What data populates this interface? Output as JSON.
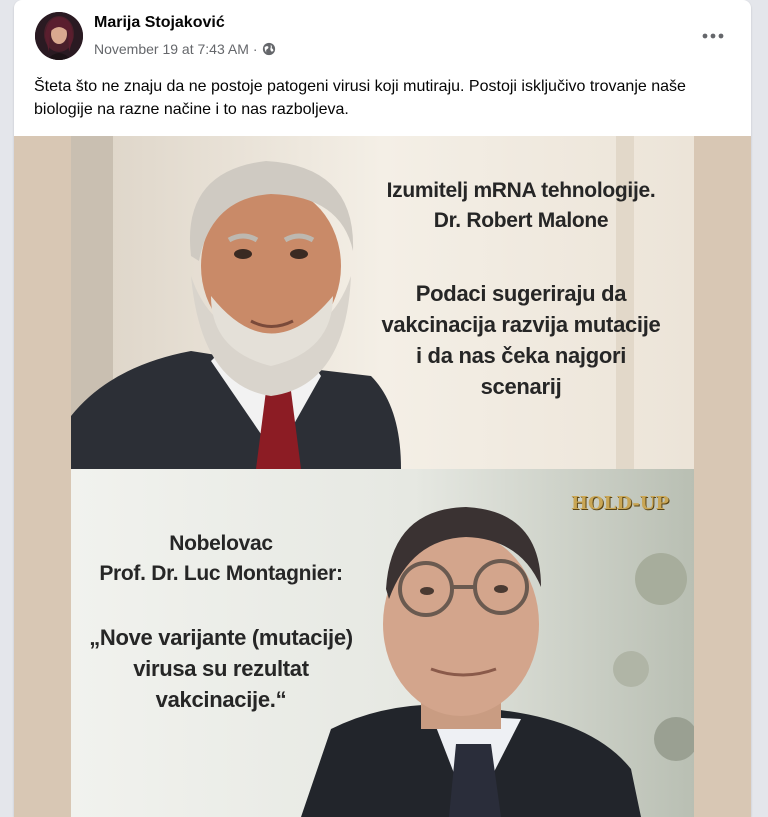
{
  "post": {
    "author": "Marija Stojaković",
    "timestamp": "November 19 at 7:43 AM",
    "separator": "·",
    "audience_icon": "globe-icon",
    "more_icon": "more-options-icon",
    "caption": "Šteta što ne znaju da ne postoje patogeni virusi koji mutiraju. Postoji isključivo trovanje naše biologije na razne načine i to nas razboljeva."
  },
  "meme": {
    "top": {
      "line1": "Izumitelj mRNA tehnologije.",
      "line2": "Dr. Robert Malone",
      "quote1": "Podaci sugeriraju da",
      "quote2": "vakcinacija razvija mutacije",
      "quote3": "i da nas čeka najgori",
      "quote4": "scenarij"
    },
    "bottom": {
      "line1": "Nobelovac",
      "line2": "Prof. Dr. Luc Montagnier:",
      "quote1": "„Nove varijante (mutacije)",
      "quote2": "virusa su rezultat",
      "quote3": "vakcinacije.“",
      "watermark": "HOLD-UP"
    }
  },
  "colors": {
    "text_primary": "#050505",
    "text_secondary": "#65676b",
    "frame_background": "#d8c7b4"
  }
}
